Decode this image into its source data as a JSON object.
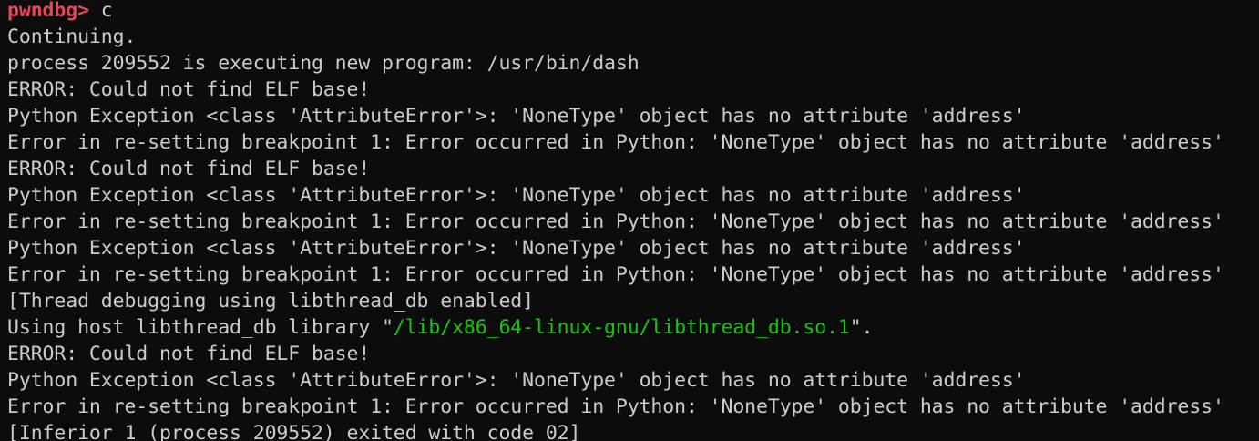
{
  "terminal": {
    "prompt": "pwndbg> ",
    "command": "c",
    "colors": {
      "background": "#0c0c0c",
      "text": "#cccccc",
      "prompt": "#e74856",
      "path": "#16c60c"
    },
    "lines": [
      "Continuing.",
      "process 209552 is executing new program: /usr/bin/dash",
      "ERROR: Could not find ELF base!",
      "Python Exception <class 'AttributeError'>: 'NoneType' object has no attribute 'address'",
      "Error in re-setting breakpoint 1: Error occurred in Python: 'NoneType' object has no attribute 'address'",
      "ERROR: Could not find ELF base!",
      "Python Exception <class 'AttributeError'>: 'NoneType' object has no attribute 'address'",
      "Error in re-setting breakpoint 1: Error occurred in Python: 'NoneType' object has no attribute 'address'",
      "Python Exception <class 'AttributeError'>: 'NoneType' object has no attribute 'address'",
      "Error in re-setting breakpoint 1: Error occurred in Python: 'NoneType' object has no attribute 'address'",
      "[Thread debugging using libthread_db enabled]"
    ],
    "libthread_line": {
      "prefix": "Using host libthread_db library \"",
      "path": "/lib/x86_64-linux-gnu/libthread_db.so.1",
      "suffix": "\"."
    },
    "trailing_lines": [
      "ERROR: Could not find ELF base!",
      "Python Exception <class 'AttributeError'>: 'NoneType' object has no attribute 'address'",
      "Error in re-setting breakpoint 1: Error occurred in Python: 'NoneType' object has no attribute 'address'",
      "[Inferior 1 (process 209552) exited with code 02]"
    ]
  }
}
